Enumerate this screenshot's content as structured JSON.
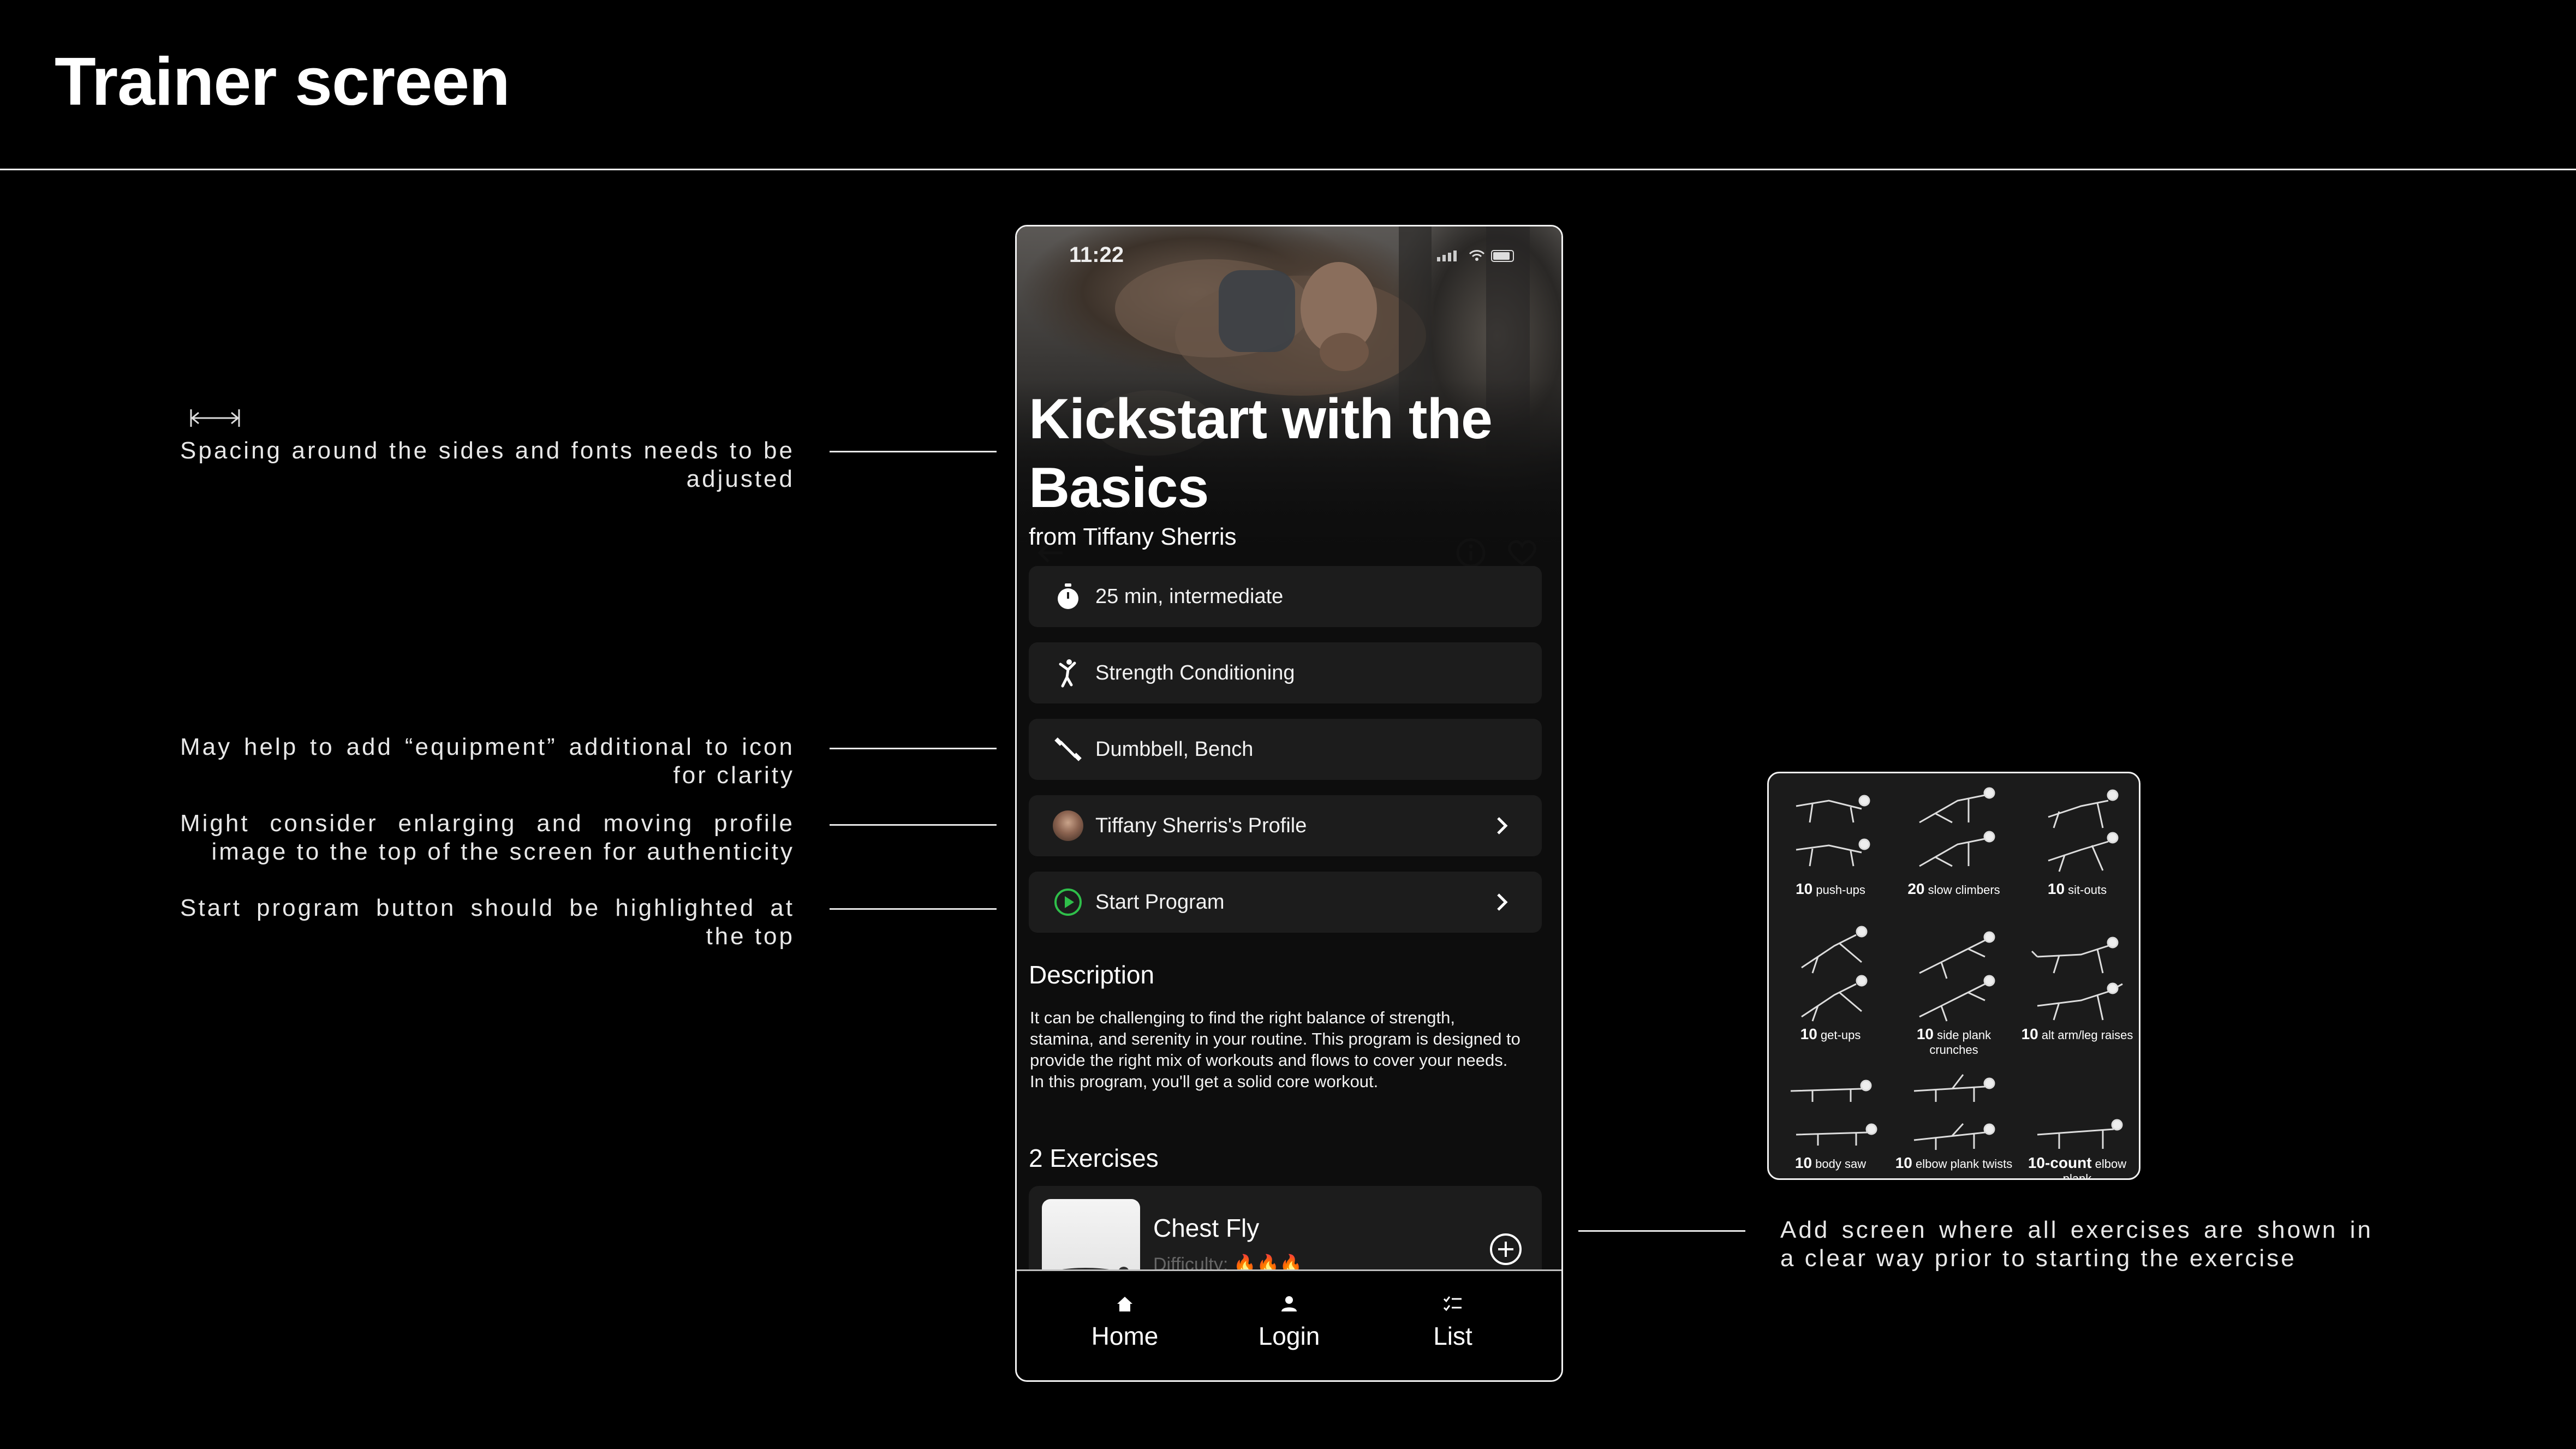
{
  "page_title": "Trainer screen",
  "annotations": {
    "spacing": "Spacing around the sides and fonts needs to be adjusted",
    "equipment": "May help to add “equipment” additional to icon for clarity",
    "profile": "Might consider enlarging and moving profile image to the top of the screen for authenticity",
    "start": "Start program button should be highlighted at the top",
    "exercises": "Add screen where all exercises are shown in a clear way prior to starting the exercise"
  },
  "phone": {
    "status_time": "11:22",
    "hero_title": "Kickstart with the Basics",
    "hero_subtitle": "from Tiffany Sherris",
    "info_rows": [
      {
        "icon": "stopwatch-icon",
        "label": "25 min, intermediate"
      },
      {
        "icon": "kick-icon",
        "label": "Strength Conditioning"
      },
      {
        "icon": "dumbbell-icon",
        "label": "Dumbbell, Bench"
      },
      {
        "icon": "avatar",
        "label": "Tiffany Sherris's Profile"
      },
      {
        "icon": "play-circle-icon",
        "label": "Start Program"
      }
    ],
    "description_heading": "Description",
    "description": "It can be challenging to find the right balance of strength, stamina, and serenity in your routine. This program is designed to provide the right mix of workouts and flows to cover your needs. In this program, you'll get a solid core workout.",
    "exercises_heading": "2 Exercises",
    "exercise": {
      "name": "Chest Fly",
      "difficulty_label": "Difficulty:",
      "difficulty_icons": "🔥🔥🔥"
    },
    "tabs": [
      {
        "icon": "home-icon",
        "label": "Home"
      },
      {
        "icon": "user-icon",
        "label": "Login"
      },
      {
        "icon": "checklist-icon",
        "label": "List"
      }
    ],
    "accent_color": "#2fbf4a"
  },
  "exercise_grid": [
    {
      "count": "10",
      "name": "push-ups"
    },
    {
      "count": "20",
      "name": "slow climbers"
    },
    {
      "count": "10",
      "name": "sit-outs"
    },
    {
      "count": "10",
      "name": "get-ups"
    },
    {
      "count": "10",
      "name": "side plank crunches"
    },
    {
      "count": "10",
      "name": "alt arm/leg raises"
    },
    {
      "count": "10",
      "name": "body saw"
    },
    {
      "count": "10",
      "name": "elbow plank twists"
    },
    {
      "count": "10-count",
      "name": "elbow plank"
    }
  ]
}
